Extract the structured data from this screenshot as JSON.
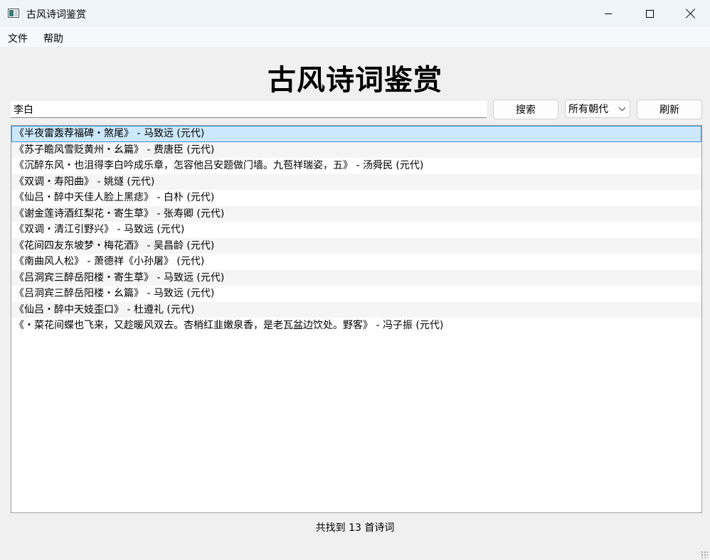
{
  "window": {
    "title": "古风诗词鉴赏"
  },
  "menu": {
    "file": "文件",
    "help": "帮助"
  },
  "heading": "古风诗词鉴赏",
  "search": {
    "value": "李白",
    "button": "搜索"
  },
  "dynasty_filter": {
    "selected": "所有朝代"
  },
  "refresh_button": "刷新",
  "results": [
    "《半夜雷轰荐福碑・煞尾》 - 马致远 (元代)",
    "《苏子瞻风雪贬黄州・幺篇》 - 费唐臣 (元代)",
    "《沉醉东风・也沮得李白吟成乐章，怎容他吕安题做门墙。九苞祥瑞姿，五》 - 汤舜民 (元代)",
    "《双调・寿阳曲》 - 姚燧 (元代)",
    "《仙吕・醉中天佳人脸上黑痣》 - 白朴 (元代)",
    "《谢金莲诗酒红梨花・寄生草》 - 张寿卿 (元代)",
    "《双调・清江引野兴》 - 马致远 (元代)",
    "《花间四友东坡梦・梅花酒》 - 吴昌龄 (元代)",
    "《南曲风人松》 - 萧德祥《小孙屠》 (元代)",
    "《吕洞宾三醉岳阳楼・寄生草》 - 马致远 (元代)",
    "《吕洞宾三醉岳阳楼・幺篇》 - 马致远 (元代)",
    "《仙吕・醉中天妓歪口》 - 杜遵礼 (元代)",
    "《・菜花间蝶也飞来，又趁暖风双去。杏梢红韭嫩泉香，是老瓦盆边饮处。野客》 - 冯子振 (元代)"
  ],
  "status": "共找到 13 首诗词"
}
